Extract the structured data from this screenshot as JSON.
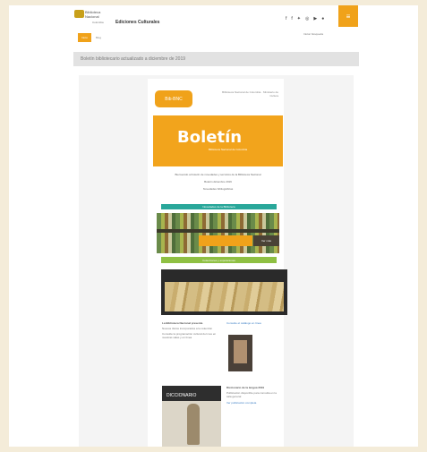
{
  "header": {
    "logo_line1": "Biblioteca",
    "logo_line2": "Nacional",
    "logo_line3": "Colombia",
    "site_title": "Ediciones Culturales",
    "social_icons": [
      "facebook-icon",
      "facebook-icon",
      "twitter-icon",
      "instagram-icon",
      "youtube-icon",
      "flickr-icon"
    ],
    "menu_icon": "≡",
    "search_label": "Iniciar búsqueda"
  },
  "nav": {
    "home_label": "Inicio",
    "link_label": "Blog"
  },
  "page_title": "Boletín bibliotecario actualizado a diciembre de 2019",
  "newsletter": {
    "bib_logo": "Bib·BNC",
    "header_note": "Biblioteca Nacional de Colombia · Ministerio de Cultura",
    "banner_title": "Boletín",
    "banner_sub": "Biblioteca Nacional de Colombia",
    "intro_lines": [
      "Bienvenido al boletín de novedades y servicios de la Biblioteca Nacional",
      "Boletín diciembre 2019",
      "Novedades bibliográficas"
    ],
    "teal_label": "Novedades de la Biblioteca",
    "photo1_label": "Ver más",
    "green_label": "Colecciones y exposiciones",
    "book1_title": "La Biblioteca Nacional presenta",
    "book1_paras": [
      "Nuevos títulos incorporados a la colección",
      "Consulte la programación cultural del mes en nuestras salas y en línea"
    ],
    "book1_link": "Consulte el catálogo en línea",
    "book2_cover": "DICCIONARIO",
    "book2_title": "Diccionario de la lengua 2019",
    "book2_para": "Publicación disponible para consulta en la sala general",
    "book2_link": "Ver publicación completa"
  }
}
